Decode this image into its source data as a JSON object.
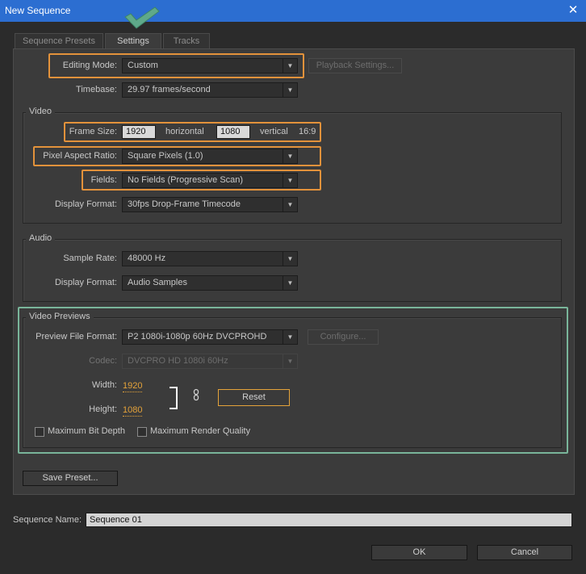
{
  "window": {
    "title": "New Sequence",
    "close_glyph": "✕"
  },
  "tabs": [
    {
      "label": "Sequence Presets",
      "active": false
    },
    {
      "label": "Settings",
      "active": true
    },
    {
      "label": "Tracks",
      "active": false
    }
  ],
  "settings": {
    "editing_mode": {
      "label": "Editing Mode:",
      "value": "Custom"
    },
    "playback_settings_label": "Playback Settings...",
    "timebase": {
      "label": "Timebase:",
      "value": "29.97 frames/second"
    }
  },
  "video": {
    "group_label": "Video",
    "frame_size": {
      "label": "Frame Size:",
      "horizontal_value": "1920",
      "horizontal_label": "horizontal",
      "vertical_value": "1080",
      "vertical_label": "vertical",
      "aspect": "16:9"
    },
    "pixel_aspect_ratio": {
      "label": "Pixel Aspect Ratio:",
      "value": "Square Pixels (1.0)"
    },
    "fields": {
      "label": "Fields:",
      "value": "No Fields (Progressive Scan)"
    },
    "display_format": {
      "label": "Display Format:",
      "value": "30fps Drop-Frame Timecode"
    }
  },
  "audio": {
    "group_label": "Audio",
    "sample_rate": {
      "label": "Sample Rate:",
      "value": "48000 Hz"
    },
    "display_format": {
      "label": "Display Format:",
      "value": "Audio Samples"
    }
  },
  "video_previews": {
    "group_label": "Video Previews",
    "preview_file_format": {
      "label": "Preview File Format:",
      "value": "P2 1080i-1080p 60Hz DVCPROHD"
    },
    "configure_label": "Configure...",
    "codec": {
      "label": "Codec:",
      "value": "DVCPRO HD 1080i 60Hz"
    },
    "width": {
      "label": "Width:",
      "value": "1920"
    },
    "height": {
      "label": "Height:",
      "value": "1080"
    },
    "reset_label": "Reset",
    "maximum_bit_depth": {
      "label": "Maximum Bit Depth",
      "checked": false
    },
    "maximum_render_quality": {
      "label": "Maximum Render Quality",
      "checked": false
    }
  },
  "save_preset_label": "Save Preset...",
  "sequence_name": {
    "label": "Sequence Name:",
    "value": "Sequence 01"
  },
  "buttons": {
    "ok": "OK",
    "cancel": "Cancel"
  },
  "colors": {
    "titlebar": "#2c6ed1",
    "highlight_orange": "#e3923b",
    "highlight_green": "#79b59a",
    "value_orange": "#e5a33a",
    "checkmark": "#5fa98a"
  },
  "icons": {
    "close": "close-icon",
    "checkmark": "checkmark-icon",
    "dropdown_arrow": "triangle-down-icon",
    "link": "chain-link-icon"
  }
}
